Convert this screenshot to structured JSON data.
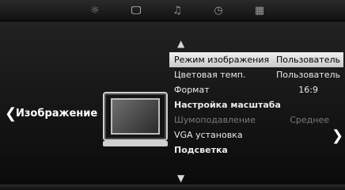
{
  "tabs": [
    {
      "name": "picture-tab",
      "icon": "sun-icon",
      "glyph": "☼",
      "active": false
    },
    {
      "name": "monitor-tab",
      "icon": "monitor-icon",
      "glyph": "🖵",
      "active": true
    },
    {
      "name": "sound-tab",
      "icon": "music-note-icon",
      "glyph": "♫",
      "active": false
    },
    {
      "name": "time-tab",
      "icon": "clock-icon",
      "glyph": "◷",
      "active": false
    },
    {
      "name": "settings-tab",
      "icon": "grid-icon",
      "glyph": "▦",
      "active": false
    }
  ],
  "section": {
    "title": "Изображение"
  },
  "menu": {
    "items": [
      {
        "label": "Режим изображения",
        "value": "Пользователь",
        "state": "selected"
      },
      {
        "label": "Цветовая темп.",
        "value": "Пользователь",
        "state": "normal"
      },
      {
        "label": "Формат",
        "value": "16:9",
        "state": "normal"
      },
      {
        "label": "Настройка масштаба",
        "value": "",
        "state": "bold"
      },
      {
        "label": "Шумоподавление",
        "value": "Среднее",
        "state": "disabled"
      },
      {
        "label": "VGA установка",
        "value": "",
        "state": "normal"
      },
      {
        "label": "Подсветка",
        "value": "",
        "state": "bold"
      }
    ]
  },
  "colors": {
    "selected_bg": "#d8d8d8",
    "text": "#eaeaea",
    "disabled": "#7a7a7a"
  }
}
